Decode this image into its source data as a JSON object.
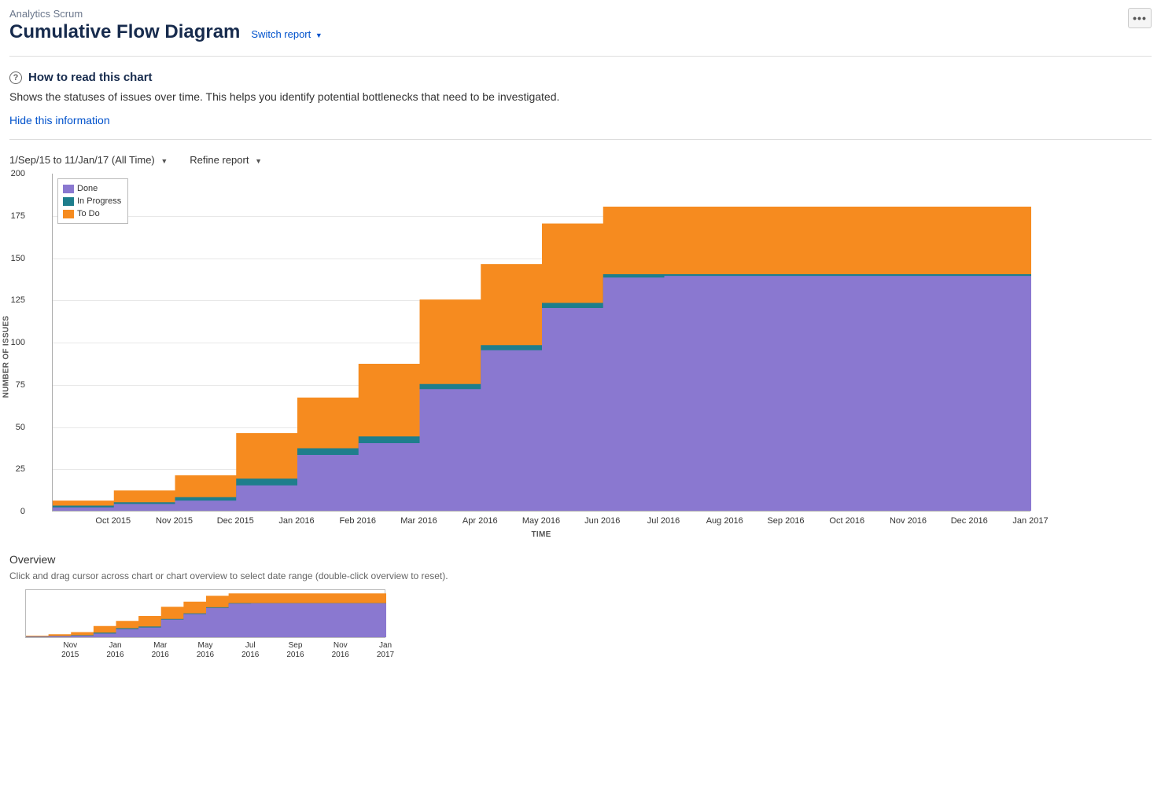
{
  "header": {
    "breadcrumb": "Analytics Scrum",
    "title": "Cumulative Flow Diagram",
    "switch_report": "Switch report",
    "more_label": "•••"
  },
  "howto": {
    "title": "How to read this chart",
    "body": "Shows the statuses of issues over time. This helps you identify potential bottlenecks that need to be investigated.",
    "hide": "Hide this information"
  },
  "filters": {
    "range": "1/Sep/15 to 11/Jan/17 (All Time)",
    "refine": "Refine report"
  },
  "legend": {
    "done": "Done",
    "in_progress": "In Progress",
    "todo": "To Do"
  },
  "colors": {
    "done": "#8a78d0",
    "in_progress": "#1e7e8c",
    "todo": "#f68b1f"
  },
  "overview": {
    "title": "Overview",
    "note": "Click and drag cursor across chart or chart overview to select date range (double-click overview to reset)."
  },
  "chart_data": {
    "type": "area",
    "title": "Cumulative Flow Diagram",
    "xlabel": "TIME",
    "ylabel": "NUMBER OF ISSUES",
    "x_ticks": [
      "Oct 2015",
      "Nov 2015",
      "Dec 2015",
      "Jan 2016",
      "Feb 2016",
      "Mar 2016",
      "Apr 2016",
      "May 2016",
      "Jun 2016",
      "Jul 2016",
      "Aug 2016",
      "Sep 2016",
      "Oct 2016",
      "Nov 2016",
      "Dec 2016",
      "Jan 2017"
    ],
    "y_ticks": [
      0,
      25,
      50,
      75,
      100,
      125,
      150,
      175,
      200
    ],
    "ylim": [
      0,
      200
    ],
    "categories": [
      "Sep 2015",
      "Oct 2015",
      "Nov 2015",
      "Dec 2015",
      "Jan 2016",
      "Feb 2016",
      "Mar 2016",
      "Apr 2016",
      "May 2016",
      "Jun 2016",
      "Jul 2016",
      "Aug 2016",
      "Sep 2016",
      "Oct 2016",
      "Nov 2016",
      "Dec 2016",
      "Jan 2017"
    ],
    "series": [
      {
        "name": "Done",
        "values": [
          2,
          4,
          6,
          15,
          33,
          40,
          72,
          95,
          120,
          138,
          139,
          139,
          139,
          139,
          139,
          139,
          139
        ]
      },
      {
        "name": "In Progress",
        "values": [
          1,
          1,
          2,
          4,
          4,
          4,
          3,
          3,
          3,
          2,
          1,
          1,
          1,
          1,
          1,
          1,
          1
        ]
      },
      {
        "name": "To Do",
        "values": [
          3,
          7,
          13,
          27,
          30,
          43,
          50,
          48,
          47,
          40,
          40,
          40,
          40,
          40,
          40,
          40,
          40
        ]
      }
    ],
    "overview_x_ticks": [
      "Nov 2015",
      "Jan 2016",
      "Mar 2016",
      "May 2016",
      "Jul 2016",
      "Sep 2016",
      "Nov 2016",
      "Jan 2017"
    ]
  }
}
